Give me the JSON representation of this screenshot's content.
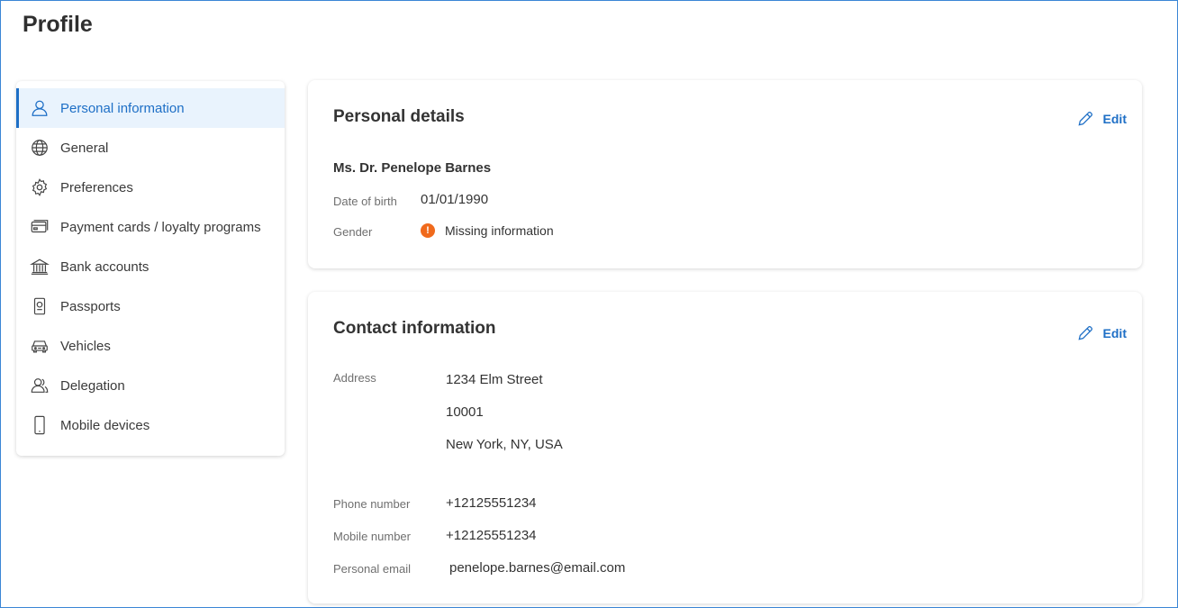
{
  "page": {
    "title": "Profile"
  },
  "sidebar": {
    "items": [
      {
        "label": "Personal information",
        "icon": "user-icon",
        "active": true
      },
      {
        "label": "General",
        "icon": "globe-icon",
        "active": false
      },
      {
        "label": "Preferences",
        "icon": "gear-icon",
        "active": false
      },
      {
        "label": "Payment cards / loyalty programs",
        "icon": "credit-card-icon",
        "active": false
      },
      {
        "label": "Bank accounts",
        "icon": "bank-icon",
        "active": false
      },
      {
        "label": "Passports",
        "icon": "passport-icon",
        "active": false
      },
      {
        "label": "Vehicles",
        "icon": "car-icon",
        "active": false
      },
      {
        "label": "Delegation",
        "icon": "users-icon",
        "active": false
      },
      {
        "label": "Mobile devices",
        "icon": "mobile-icon",
        "active": false
      }
    ]
  },
  "personal_details": {
    "title": "Personal details",
    "edit_label": "Edit",
    "full_name": "Ms. Dr. Penelope Barnes",
    "dob_label": "Date of birth",
    "dob_value": "01/01/1990",
    "gender_label": "Gender",
    "gender_value": "Missing information"
  },
  "contact_information": {
    "title": "Contact information",
    "edit_label": "Edit",
    "address_label": "Address",
    "address_line1": "1234 Elm Street",
    "address_line2": "10001",
    "address_line3": "New York, NY, USA",
    "phone_label": "Phone number",
    "phone_value": "+12125551234",
    "mobile_label": "Mobile number",
    "mobile_value": "+12125551234",
    "email_label": "Personal email",
    "email_value": "penelope.barnes@email.com"
  },
  "colors": {
    "accent": "#1e6fc6",
    "active_bg": "#e9f3fd",
    "warning": "#f06a1c",
    "frame_border": "#3b86d6"
  }
}
